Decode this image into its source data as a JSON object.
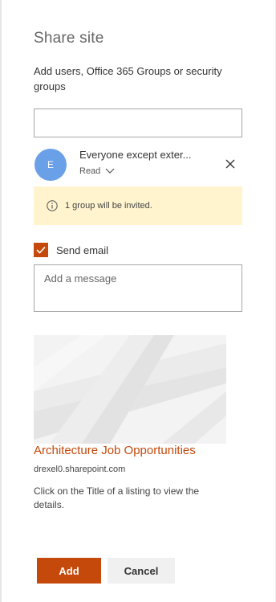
{
  "panel": {
    "title": "Share site",
    "subtitle": "Add users, Office 365 Groups or security groups"
  },
  "people_input": {
    "value": ""
  },
  "persona": {
    "initial": "E",
    "name": "Everyone except exter...",
    "permission": "Read",
    "icons": {
      "dropdown": "chevron-down-icon",
      "remove": "close-icon"
    }
  },
  "notice": {
    "text": "1 group will be invited.",
    "icon": "info-icon"
  },
  "send_email": {
    "label": "Send email",
    "checked": true
  },
  "message": {
    "placeholder": "Add a message",
    "value": ""
  },
  "site_card": {
    "title": "Architecture Job Opportunities",
    "url": "drexel0.sharepoint.com",
    "description": "Click on the Title of a listing to view the details."
  },
  "buttons": {
    "add": "Add",
    "cancel": "Cancel"
  },
  "colors": {
    "accent": "#c4490b",
    "notice_bg": "#fff4ce",
    "avatar": "#6aa0e8"
  }
}
